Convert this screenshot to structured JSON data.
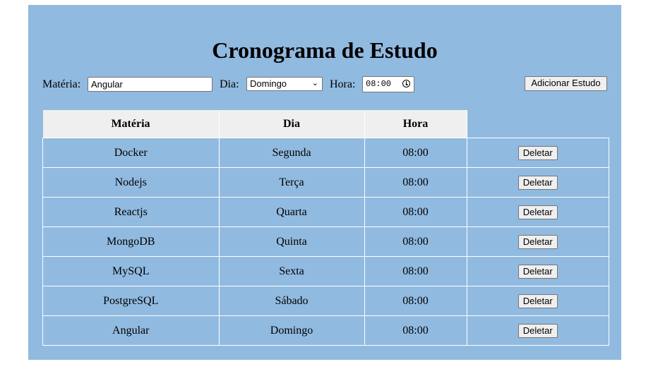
{
  "title": "Cronograma de Estudo",
  "form": {
    "materia_label": "Matéria:",
    "materia_value": "Angular",
    "dia_label": "Dia:",
    "dia_value": "Domingo",
    "hora_label": "Hora:",
    "hora_value": "08:00",
    "add_button": "Adicionar Estudo"
  },
  "table": {
    "headers": [
      "Matéria",
      "Dia",
      "Hora"
    ],
    "delete_label": "Deletar",
    "rows": [
      {
        "materia": "Docker",
        "dia": "Segunda",
        "hora": "08:00"
      },
      {
        "materia": "Nodejs",
        "dia": "Terça",
        "hora": "08:00"
      },
      {
        "materia": "Reactjs",
        "dia": "Quarta",
        "hora": "08:00"
      },
      {
        "materia": "MongoDB",
        "dia": "Quinta",
        "hora": "08:00"
      },
      {
        "materia": "MySQL",
        "dia": "Sexta",
        "hora": "08:00"
      },
      {
        "materia": "PostgreSQL",
        "dia": "Sábado",
        "hora": "08:00"
      },
      {
        "materia": "Angular",
        "dia": "Domingo",
        "hora": "08:00"
      }
    ]
  },
  "colors": {
    "panel_background": "#91bae0",
    "header_background": "#efefef"
  }
}
